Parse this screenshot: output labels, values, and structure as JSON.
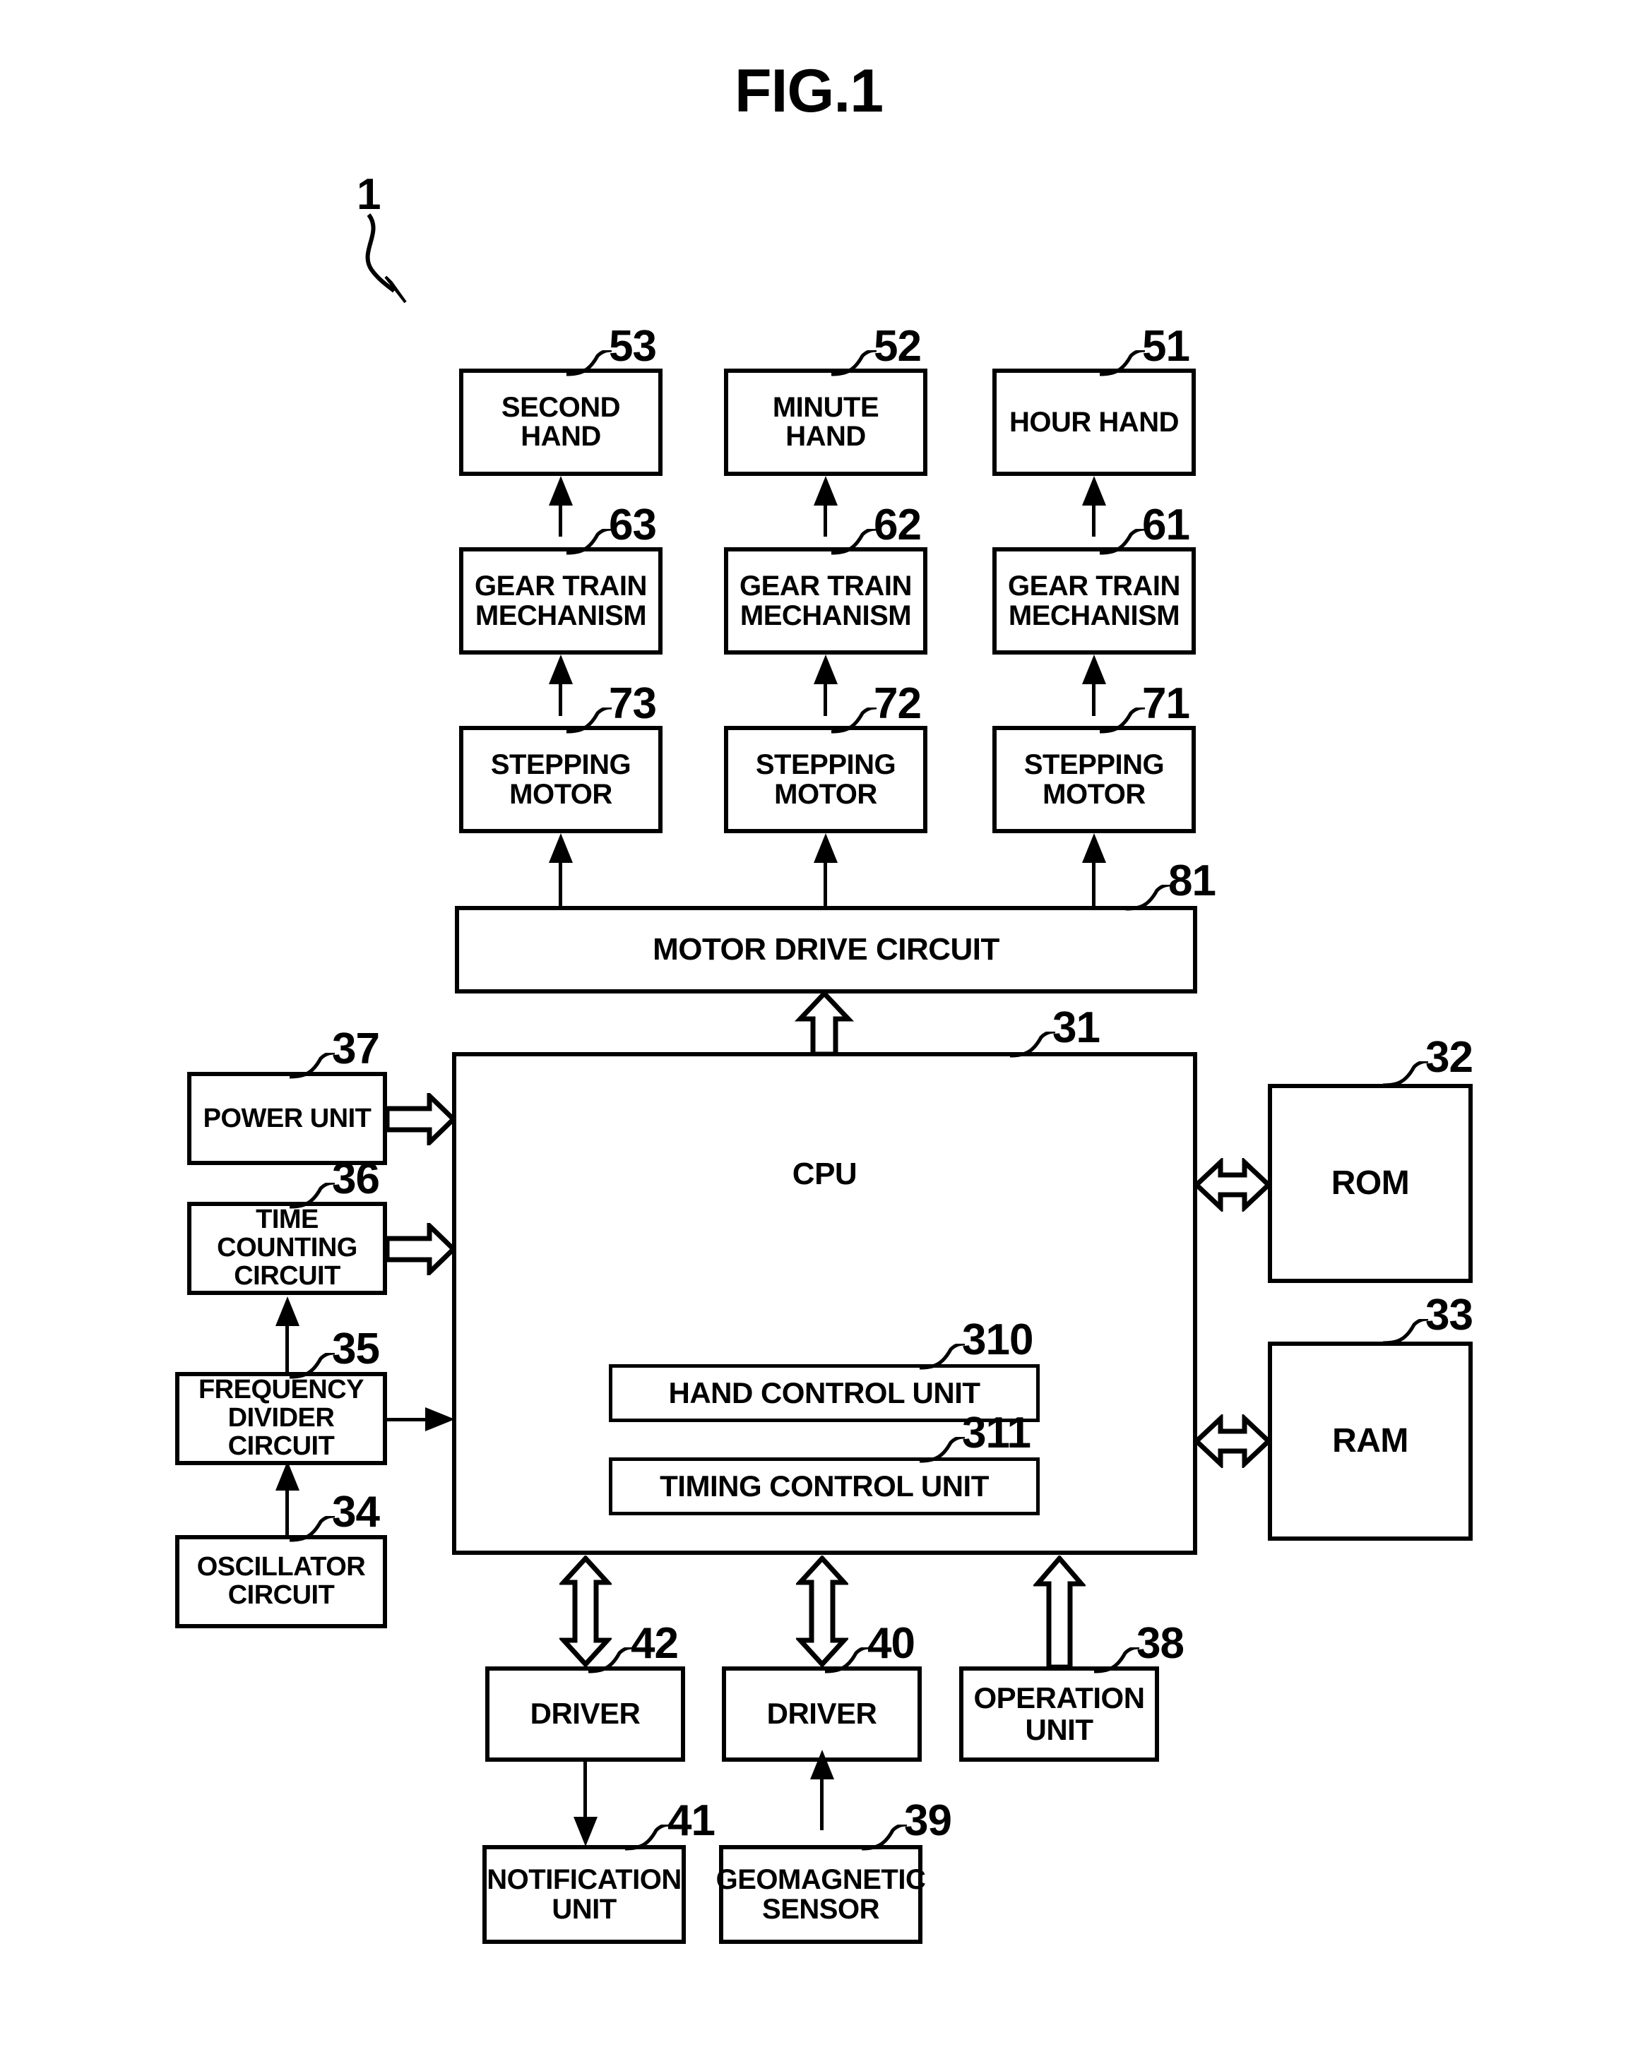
{
  "figure": {
    "title": "FIG.1",
    "system_ref": "1"
  },
  "blocks": {
    "second_hand": {
      "label": "SECOND HAND",
      "ref": "53"
    },
    "minute_hand": {
      "label": "MINUTE HAND",
      "ref": "52"
    },
    "hour_hand": {
      "label": "HOUR HAND",
      "ref": "51"
    },
    "gear_train_3": {
      "label_line1": "GEAR TRAIN",
      "label_line2": "MECHANISM",
      "ref": "63"
    },
    "gear_train_2": {
      "label_line1": "GEAR TRAIN",
      "label_line2": "MECHANISM",
      "ref": "62"
    },
    "gear_train_1": {
      "label_line1": "GEAR TRAIN",
      "label_line2": "MECHANISM",
      "ref": "61"
    },
    "stepping_motor_3": {
      "label_line1": "STEPPING",
      "label_line2": "MOTOR",
      "ref": "73"
    },
    "stepping_motor_2": {
      "label_line1": "STEPPING",
      "label_line2": "MOTOR",
      "ref": "72"
    },
    "stepping_motor_1": {
      "label_line1": "STEPPING",
      "label_line2": "MOTOR",
      "ref": "71"
    },
    "motor_drive": {
      "label": "MOTOR DRIVE CIRCUIT",
      "ref": "81"
    },
    "cpu": {
      "label": "CPU",
      "ref": "31"
    },
    "hand_control": {
      "label": "HAND CONTROL UNIT",
      "ref": "310"
    },
    "timing_control": {
      "label": "TIMING CONTROL UNIT",
      "ref": "311"
    },
    "rom": {
      "label": "ROM",
      "ref": "32"
    },
    "ram": {
      "label": "RAM",
      "ref": "33"
    },
    "power_unit": {
      "label": "POWER UNIT",
      "ref": "37"
    },
    "time_counting": {
      "label_line1": "TIME COUNTING",
      "label_line2": "CIRCUIT",
      "ref": "36"
    },
    "freq_divider": {
      "label_line1": "FREQUENCY",
      "label_line2": "DIVIDER CIRCUIT",
      "ref": "35"
    },
    "oscillator": {
      "label_line1": "OSCILLATOR",
      "label_line2": "CIRCUIT",
      "ref": "34"
    },
    "driver_42": {
      "label": "DRIVER",
      "ref": "42"
    },
    "driver_40": {
      "label": "DRIVER",
      "ref": "40"
    },
    "operation_unit": {
      "label_line1": "OPERATION",
      "label_line2": "UNIT",
      "ref": "38"
    },
    "notification_unit": {
      "label_line1": "NOTIFICATION",
      "label_line2": "UNIT",
      "ref": "41"
    },
    "geomagnetic_sensor": {
      "label_line1": "GEOMAGNETIC",
      "label_line2": "SENSOR",
      "ref": "39"
    }
  },
  "colors": {
    "ink": "#000000",
    "paper": "#ffffff"
  }
}
